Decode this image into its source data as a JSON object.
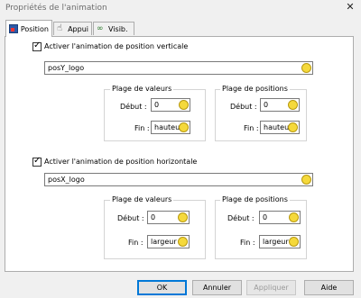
{
  "window": {
    "title": "Propriétés de l'animation"
  },
  "tabs": [
    {
      "label": "Position",
      "icon": "position-icon",
      "active": true
    },
    {
      "label": "Appui",
      "icon": "hand-icon",
      "active": false
    },
    {
      "label": "Visib.",
      "icon": "visibility-icon",
      "active": false
    }
  ],
  "vertical": {
    "checkbox_label": "Activer l'animation de position verticale",
    "checked": true,
    "expression": "posY_logo",
    "values_group": {
      "title": "Plage de valeurs",
      "start_label": "Début :",
      "start_value": "0",
      "end_label": "Fin :",
      "end_value": "hauteur"
    },
    "positions_group": {
      "title": "Plage de positions",
      "start_label": "Début :",
      "start_value": "0",
      "end_label": "Fin :",
      "end_value": "hauteur"
    }
  },
  "horizontal": {
    "checkbox_label": "Activer l'animation de position horizontale",
    "checked": true,
    "expression": "posX_logo",
    "values_group": {
      "title": "Plage de valeurs",
      "start_label": "Début :",
      "start_value": "0",
      "end_label": "Fin :",
      "end_value": "largeur"
    },
    "positions_group": {
      "title": "Plage de positions",
      "start_label": "Début :",
      "start_value": "0",
      "end_label": "Fin :",
      "end_value": "largeur"
    }
  },
  "buttons": {
    "ok": "OK",
    "cancel": "Annuler",
    "apply": "Appliquer",
    "help": "Aide"
  }
}
